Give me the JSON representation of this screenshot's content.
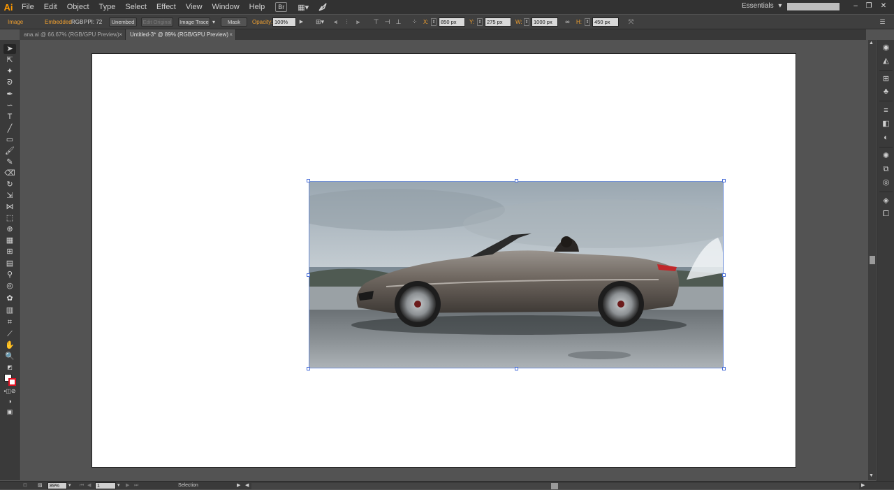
{
  "app": {
    "logo": "Ai"
  },
  "menu": [
    "File",
    "Edit",
    "Object",
    "Type",
    "Select",
    "Effect",
    "View",
    "Window",
    "Help"
  ],
  "menu_icons": {
    "bridge": "Br",
    "arrange": "▦▾",
    "sync": "sync-icon"
  },
  "workspace": {
    "label": "Essentials",
    "caret": "▾"
  },
  "search": {
    "placeholder": ""
  },
  "window_controls": {
    "minimize": "–",
    "restore": "❐",
    "close": "✕"
  },
  "control_bar": {
    "object_type": "Image",
    "embedded": "Embedded",
    "color_mode": "RGB",
    "ppi": "PPI: 72",
    "unembed": "Unembed",
    "edit_original": "Edit Original",
    "image_trace": "Image Trace",
    "image_trace_caret": "▾",
    "mask": "Mask",
    "opacity_label": "Opacity:",
    "opacity_value": "100%",
    "x_label": "X:",
    "x_value": "850 px",
    "y_label": "Y:",
    "y_value": "275 px",
    "w_label": "W:",
    "w_value": "1000 px",
    "h_label": "H:",
    "h_value": "450 px"
  },
  "tabs": [
    {
      "label": "ana.ai @ 66.67% (RGB/GPU Preview)",
      "active": false
    },
    {
      "label": "Untitled-3* @ 89% (RGB/GPU Preview)",
      "active": true
    }
  ],
  "tab_close": "×",
  "tools": [
    "selection-tool",
    "direct-selection-tool",
    "magic-wand-tool",
    "lasso-tool",
    "pen-tool",
    "curvature-tool",
    "type-tool",
    "line-segment-tool",
    "rectangle-tool",
    "paintbrush-tool",
    "pencil-tool",
    "eraser-tool",
    "rotate-tool",
    "scale-tool",
    "width-tool",
    "free-transform-tool",
    "shape-builder-tool",
    "perspective-grid-tool",
    "mesh-tool",
    "gradient-tool",
    "eyedropper-tool",
    "blend-tool",
    "symbol-sprayer-tool",
    "column-graph-tool",
    "artboard-tool",
    "slice-tool",
    "hand-tool",
    "zoom-tool"
  ],
  "status_bar": {
    "zoom": "89%",
    "artboard_number": "1",
    "tool_name": "Selection"
  },
  "colors": {
    "ui_dark": "#323232",
    "ui_panel": "#3a3a3a",
    "canvas": "#535353",
    "accent_orange": "#f0a030",
    "selection_blue": "#4a6fd8"
  }
}
